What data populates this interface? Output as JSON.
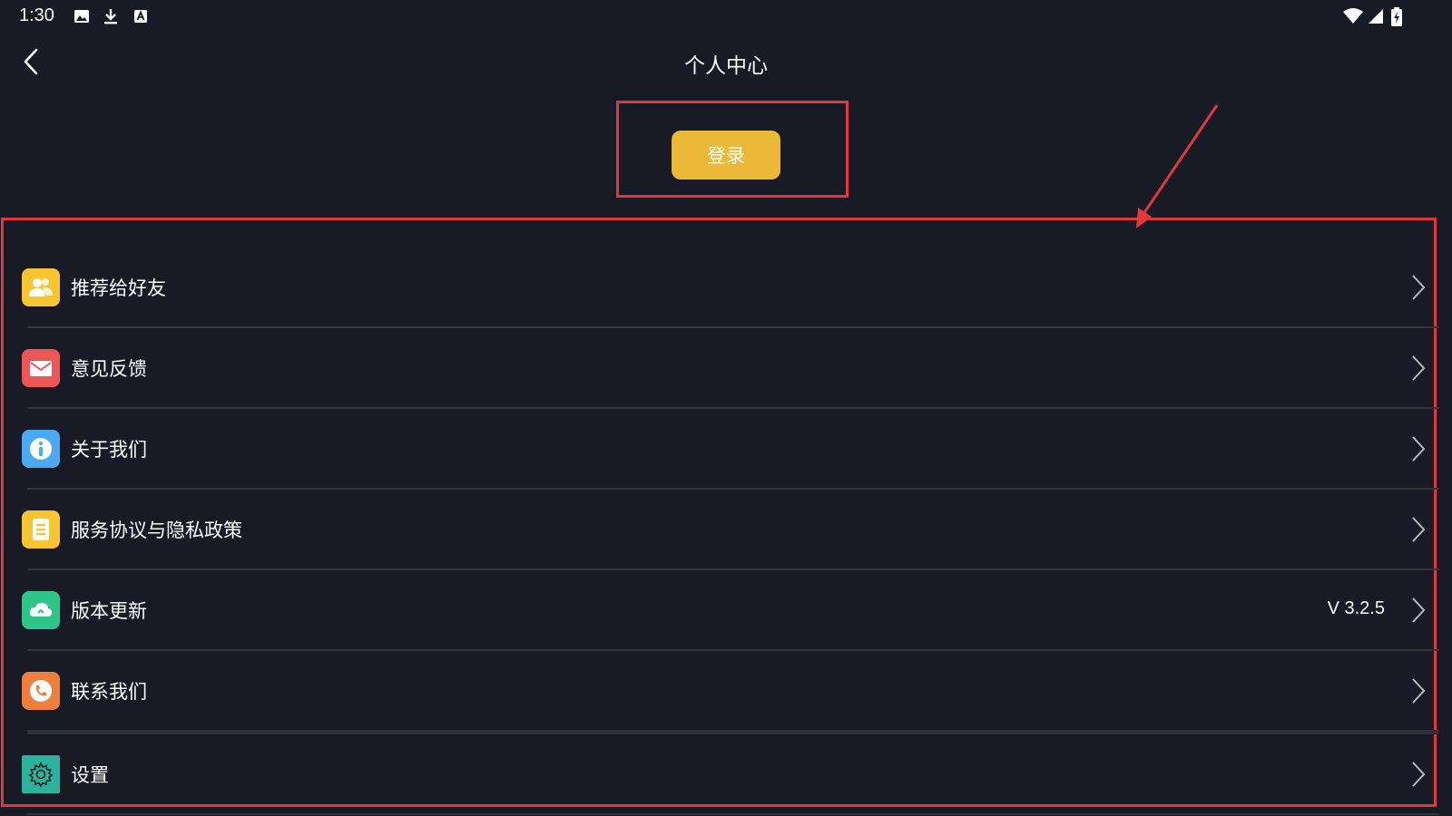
{
  "status_bar": {
    "time": "1:30",
    "left_icons": [
      "image-icon",
      "download-icon",
      "keyboard-icon"
    ],
    "right_icons": [
      "wifi-icon",
      "signal-icon",
      "battery-charging-icon"
    ]
  },
  "header": {
    "title": "个人中心",
    "back_icon": "chevron-left-icon"
  },
  "login": {
    "label": "登录"
  },
  "menu": {
    "items": [
      {
        "label": "推荐给好友",
        "icon": "share-friends-icon",
        "icon_color": "#f7c531"
      },
      {
        "label": "意见反馈",
        "icon": "mail-icon",
        "icon_color": "#ee5757"
      },
      {
        "label": "关于我们",
        "icon": "info-icon",
        "icon_color": "#4ba9f2"
      },
      {
        "label": "服务协议与隐私政策",
        "icon": "document-icon",
        "icon_color": "#f7c531"
      },
      {
        "label": "版本更新",
        "icon": "cloud-icon",
        "icon_color": "#2ec48a",
        "value": "V 3.2.5"
      },
      {
        "label": "联系我们",
        "icon": "phone-icon",
        "icon_color": "#ee7f3f"
      },
      {
        "label": "设置",
        "icon": "gear-icon",
        "icon_color": "#2bb39b"
      }
    ]
  },
  "colors": {
    "background": "#181a26",
    "accent": "#ebb838",
    "annotation": "#e0383c"
  }
}
